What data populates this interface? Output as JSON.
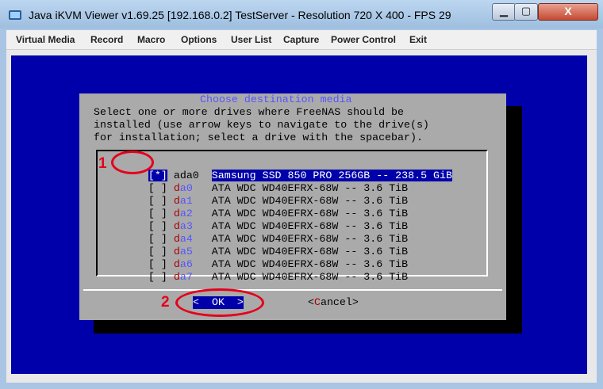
{
  "window": {
    "title": "Java iKVM Viewer v1.69.25 [192.168.0.2] TestServer - Resolution 720 X 400 - FPS 29",
    "min_glyph": "▁",
    "max_glyph": "▢",
    "close_glyph": "X"
  },
  "menu": [
    "Virtual Media",
    "Record",
    "Macro",
    "Options",
    "User List",
    "Capture",
    "Power Control",
    "Exit"
  ],
  "dialog": {
    "title": "Choose destination media",
    "prompt": [
      "Select one or more drives where FreeNAS should be",
      "installed (use arrow keys to navigate to the drive(s)",
      "for installation; select a drive with the spacebar)."
    ],
    "drives": [
      {
        "check": "[*]",
        "dev_prefix": "a",
        "dev_rest": "da0",
        "desc": "Samsung SSD 850 PRO 256GB -- 238.5 GiB",
        "selected": true
      },
      {
        "check": "[ ]",
        "dev_prefix": "d",
        "dev_rest": "a0",
        "desc": "ATA WDC WD40EFRX-68W -- 3.6 TiB",
        "selected": false
      },
      {
        "check": "[ ]",
        "dev_prefix": "d",
        "dev_rest": "a1",
        "desc": "ATA WDC WD40EFRX-68W -- 3.6 TiB",
        "selected": false
      },
      {
        "check": "[ ]",
        "dev_prefix": "d",
        "dev_rest": "a2",
        "desc": "ATA WDC WD40EFRX-68W -- 3.6 TiB",
        "selected": false
      },
      {
        "check": "[ ]",
        "dev_prefix": "d",
        "dev_rest": "a3",
        "desc": "ATA WDC WD40EFRX-68W -- 3.6 TiB",
        "selected": false
      },
      {
        "check": "[ ]",
        "dev_prefix": "d",
        "dev_rest": "a4",
        "desc": "ATA WDC WD40EFRX-68W -- 3.6 TiB",
        "selected": false
      },
      {
        "check": "[ ]",
        "dev_prefix": "d",
        "dev_rest": "a5",
        "desc": "ATA WDC WD40EFRX-68W -- 3.6 TiB",
        "selected": false
      },
      {
        "check": "[ ]",
        "dev_prefix": "d",
        "dev_rest": "a6",
        "desc": "ATA WDC WD40EFRX-68W -- 3.6 TiB",
        "selected": false
      },
      {
        "check": "[ ]",
        "dev_prefix": "d",
        "dev_rest": "a7",
        "desc": "ATA WDC WD40EFRX-68W -- 3.6 TiB",
        "selected": false
      }
    ],
    "ok": {
      "left": "<  ",
      "hot": "O",
      "rest": "K  >"
    },
    "cancel": {
      "left": "<",
      "hot": "C",
      "rest": "ancel>"
    }
  },
  "annotations": {
    "one": "1",
    "two": "2"
  },
  "colors": {
    "console_blue": "#0000aa",
    "dialog_gray": "#aaaaaa",
    "annotation_red": "#e5001b"
  }
}
